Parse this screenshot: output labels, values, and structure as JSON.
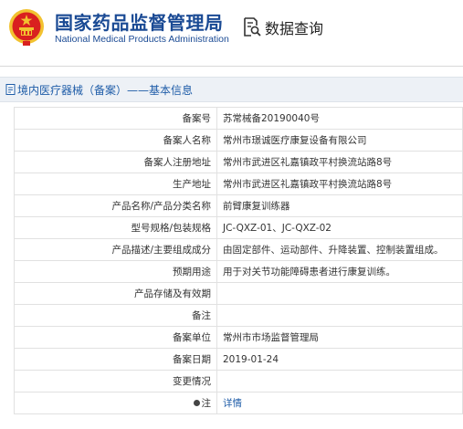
{
  "header": {
    "title_cn": "国家药品监督管理局",
    "title_en": "National Medical Products Administration",
    "query_label": "数据查询"
  },
  "section": {
    "title": "境内医疗器械（备案）——基本信息"
  },
  "rows": [
    {
      "label": "备案号",
      "value": "苏常械备20190040号"
    },
    {
      "label": "备案人名称",
      "value": "常州市璟诚医疗康复设备有限公司"
    },
    {
      "label": "备案人注册地址",
      "value": "常州市武进区礼嘉镇政平村换流站路8号"
    },
    {
      "label": "生产地址",
      "value": "常州市武进区礼嘉镇政平村换流站路8号"
    },
    {
      "label": "产品名称/产品分类名称",
      "value": "前臂康复训练器"
    },
    {
      "label": "型号规格/包装规格",
      "value": "JC-QXZ-01、JC-QXZ-02"
    },
    {
      "label": "产品描述/主要组成成分",
      "value": "由固定部件、运动部件、升降装置、控制装置组成。"
    },
    {
      "label": "预期用途",
      "value": "用于对关节功能障碍患者进行康复训练。"
    },
    {
      "label": "产品存储及有效期",
      "value": ""
    },
    {
      "label": "备注",
      "value": ""
    },
    {
      "label": "备案单位",
      "value": "常州市市场监督管理局"
    },
    {
      "label": "备案日期",
      "value": "2019-01-24"
    },
    {
      "label": "变更情况",
      "value": ""
    },
    {
      "label": "注",
      "value": "详情"
    }
  ],
  "colors": {
    "brand_blue": "#1a4a94",
    "link_blue": "#1f5da8",
    "emblem_red": "#d9201f",
    "emblem_gold": "#f2c230"
  },
  "icons": {
    "emblem": "national-emblem-icon",
    "query": "document-search-icon",
    "section": "document-icon",
    "note": "dot-icon"
  }
}
